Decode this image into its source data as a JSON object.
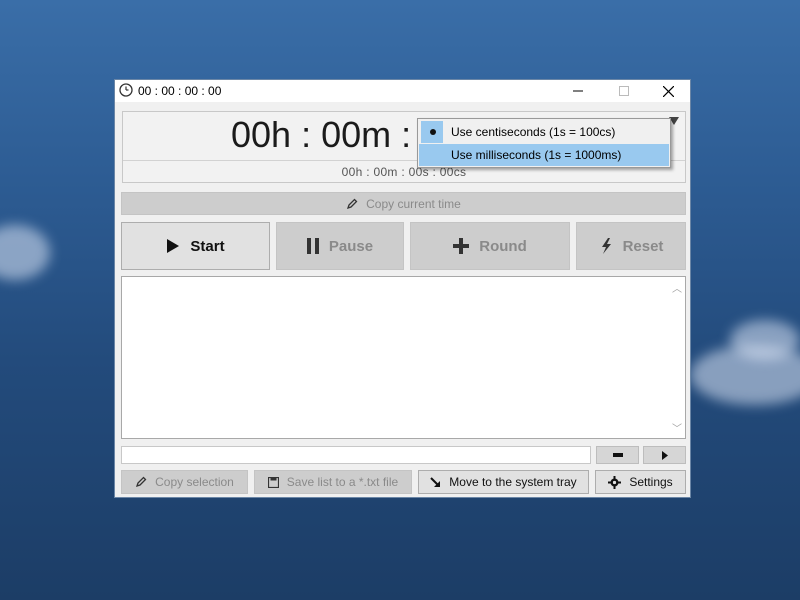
{
  "window": {
    "title": "00 : 00 : 00 : 00",
    "controls": {
      "minimize": "—",
      "maximize": "☐",
      "close": "✕"
    }
  },
  "display": {
    "main_time": "00h : 00m : 00s",
    "sub_time": "00h : 00m : 00s : 00cs",
    "precision_menu": {
      "options": [
        {
          "label": "Use centiseconds (1s = 100cs)",
          "selected": true
        },
        {
          "label": "Use milliseconds (1s = 1000ms)",
          "highlighted": true
        }
      ]
    }
  },
  "copy_current_time": {
    "label": "Copy current time",
    "enabled": false
  },
  "controls": {
    "start": {
      "label": "Start",
      "enabled": true,
      "icon": "play-icon"
    },
    "pause": {
      "label": "Pause",
      "enabled": false,
      "icon": "pause-icon"
    },
    "round": {
      "label": "Round",
      "enabled": false,
      "icon": "plus-icon"
    },
    "reset": {
      "label": "Reset",
      "enabled": false,
      "icon": "lightning-icon"
    }
  },
  "rounds_list": {
    "items": []
  },
  "input_bar": {
    "value": ""
  },
  "bottom": {
    "copy_selection": {
      "label": "Copy selection",
      "enabled": false
    },
    "save_list": {
      "label": "Save list to a *.txt file",
      "enabled": false
    },
    "system_tray": {
      "label": "Move to the system tray",
      "enabled": true
    },
    "settings": {
      "label": "Settings",
      "enabled": true
    }
  },
  "colors": {
    "highlight": "#99c9ef",
    "disabled_text": "#8a8a8a",
    "button_face": "#e1e1e1"
  }
}
